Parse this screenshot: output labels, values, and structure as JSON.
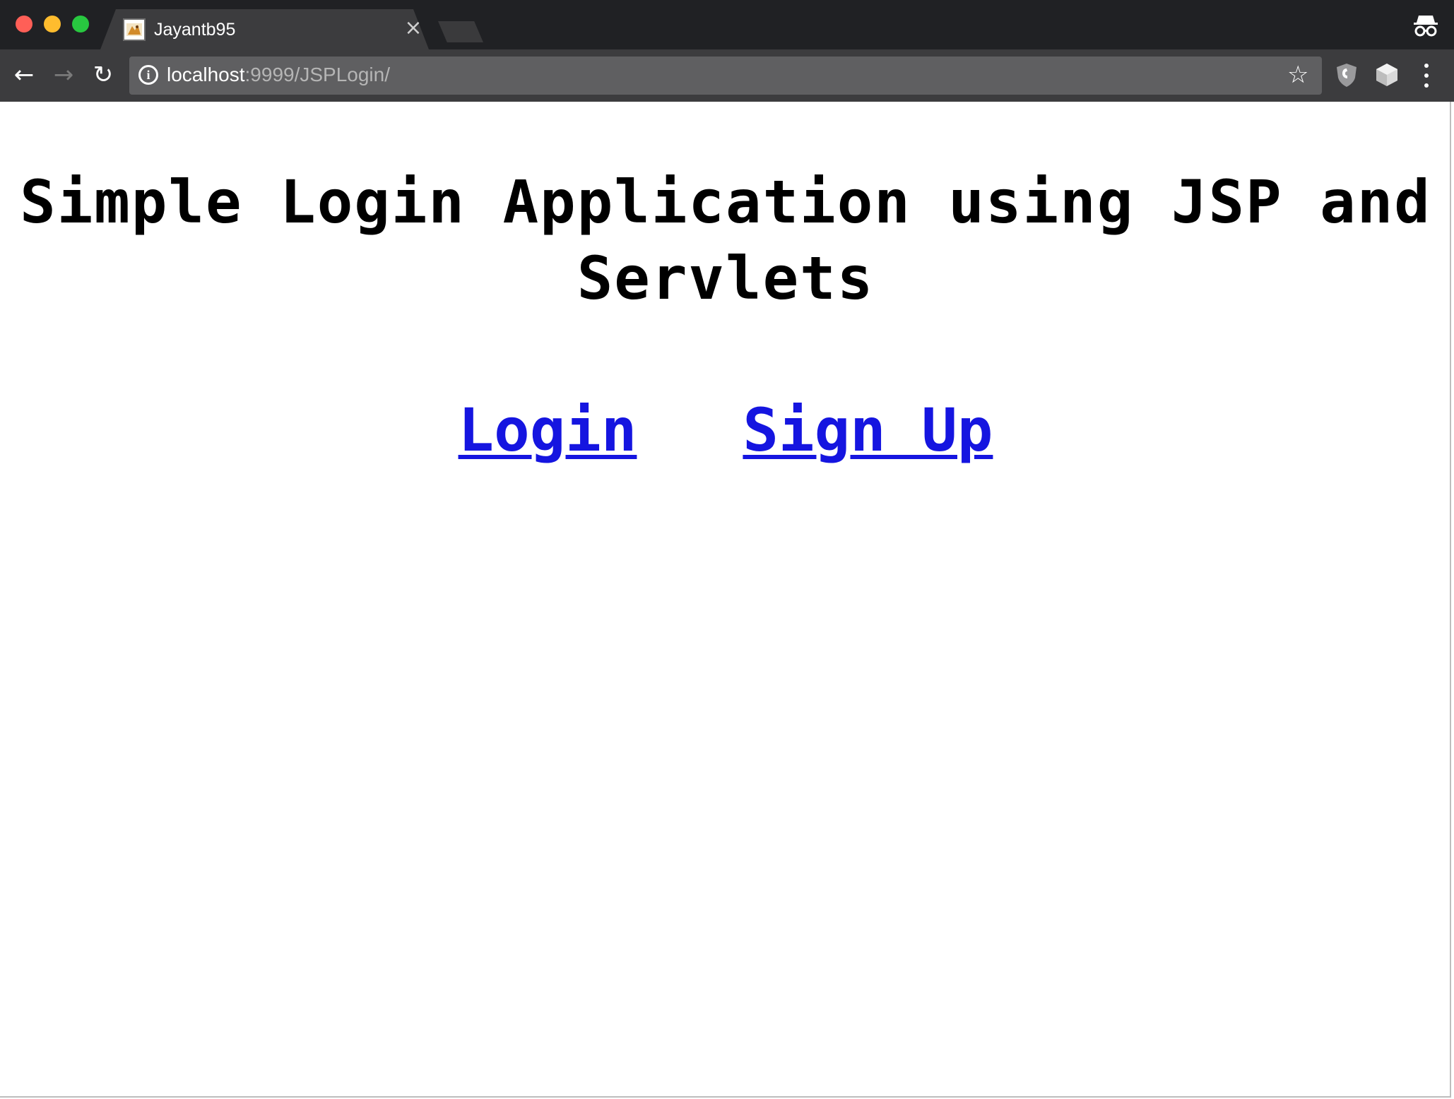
{
  "browser": {
    "tab": {
      "title": "Jayantb95",
      "favicon": "tomcat-icon",
      "close_glyph": "×"
    },
    "toolbar": {
      "back_glyph": "←",
      "forward_glyph": "→",
      "reload_glyph": "↻",
      "info_glyph": "i",
      "url_host": "localhost",
      "url_path": ":9999/JSPLogin/",
      "star_glyph": "☆"
    },
    "icons": {
      "incognito": "incognito-icon",
      "shield_extension": "shield-extension-icon",
      "cube_extension": "cube-extension-icon",
      "menu": "kebab-menu-icon"
    }
  },
  "page": {
    "heading": "Simple Login Application using JSP and Servlets",
    "links": {
      "login": "Login",
      "signup": "Sign Up"
    },
    "colors": {
      "link": "#1515e0",
      "heading": "#000000"
    }
  }
}
